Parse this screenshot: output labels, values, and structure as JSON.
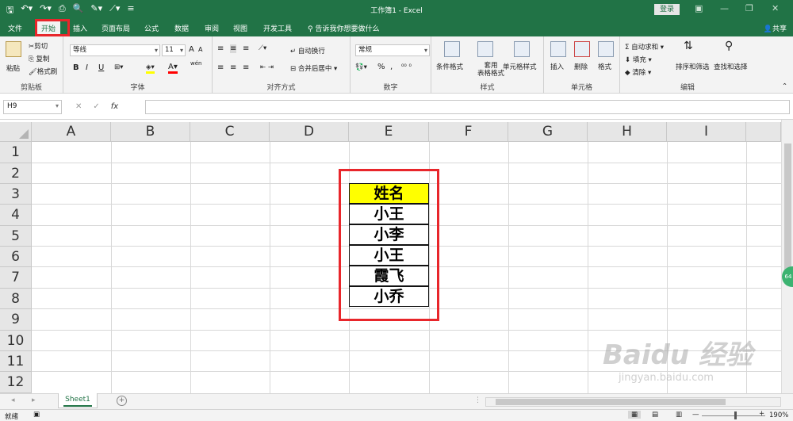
{
  "window": {
    "title": "工作簿1 - Excel",
    "login_label": "登录"
  },
  "tabs": [
    {
      "label": "文件"
    },
    {
      "label": "开始"
    },
    {
      "label": "插入"
    },
    {
      "label": "页面布局"
    },
    {
      "label": "公式"
    },
    {
      "label": "数据"
    },
    {
      "label": "审阅"
    },
    {
      "label": "视图"
    },
    {
      "label": "开发工具"
    }
  ],
  "tellme": "告诉我你想要做什么",
  "share_label": "共享",
  "ribbon": {
    "clipboard": {
      "label": "剪贴板",
      "paste": "粘贴",
      "cut": "剪切",
      "copy": "复制",
      "format_painter": "格式刷"
    },
    "font": {
      "label": "字体",
      "family": "等线",
      "size": "11",
      "bold": "B",
      "italic": "I",
      "underline": "U",
      "grow": "A",
      "shrink": "A",
      "color_letter": "A",
      "wen": "wén"
    },
    "alignment": {
      "label": "对齐方式",
      "wrap": "自动换行",
      "merge": "合并后居中"
    },
    "number": {
      "label": "数字",
      "format": "常规",
      "percent": "%",
      "comma": ","
    },
    "styles": {
      "label": "样式",
      "conditional": "条件格式",
      "table": "套用\n表格格式",
      "cell_styles": "单元格样式"
    },
    "cells": {
      "label": "单元格",
      "insert": "插入",
      "delete": "删除",
      "format": "格式"
    },
    "editing": {
      "label": "编辑",
      "autosum": "自动求和",
      "fill": "填充",
      "clear": "清除",
      "sort": "排序和筛选",
      "find": "查找和选择"
    }
  },
  "formula_bar": {
    "name_box": "H9",
    "fx": "fx",
    "value": ""
  },
  "grid": {
    "columns": [
      "A",
      "B",
      "C",
      "D",
      "E",
      "F",
      "G",
      "H",
      "I"
    ],
    "rows": [
      "1",
      "2",
      "3",
      "4",
      "5",
      "6",
      "7",
      "8",
      "9",
      "10",
      "11",
      "12"
    ],
    "table_header": "姓名",
    "table_values": [
      "小王",
      "小李",
      "小王",
      "霞飞",
      "小乔"
    ]
  },
  "sheets": [
    {
      "name": "Sheet1"
    }
  ],
  "status": {
    "ready": "就绪",
    "zoom": "190%"
  },
  "side_badge": "64",
  "watermark": {
    "brand": "Baidu 经验",
    "url": "jingyan.baidu.com"
  },
  "colors": {
    "excel_green": "#217346",
    "highlight": "#ffff00",
    "annotation_red": "#e8262b"
  }
}
